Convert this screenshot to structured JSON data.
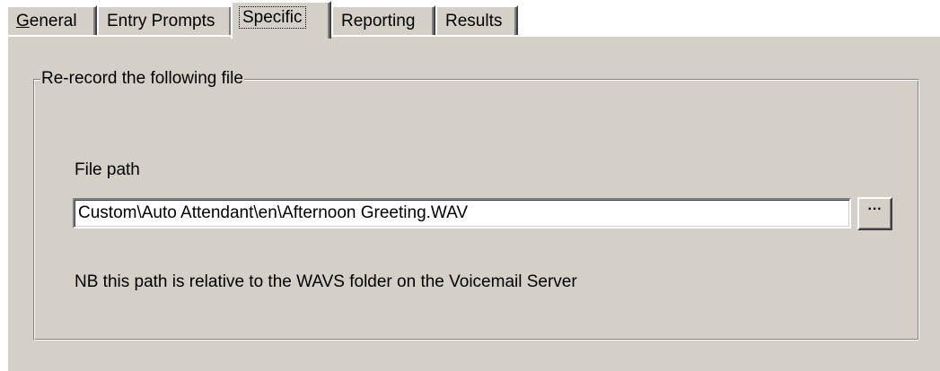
{
  "tabs": [
    {
      "mnemonic": "G",
      "rest": "eneral",
      "active": false
    },
    {
      "label": "Entry Prompts",
      "active": false
    },
    {
      "label": "Specific",
      "active": true
    },
    {
      "label": "Reporting",
      "active": false
    },
    {
      "label": "Results",
      "active": false
    }
  ],
  "group": {
    "title": "Re-record the following file"
  },
  "file_path": {
    "label": "File path",
    "value": "Custom\\Auto Attendant\\en\\Afternoon Greeting.WAV",
    "browse_label": "···"
  },
  "note": "NB this path is relative to the WAVS folder on the Voicemail Server",
  "colors": {
    "face": "#d4d0c8",
    "highlight": "#ffffff",
    "shadow": "#808080",
    "dark_shadow": "#404040",
    "input_bg": "#ffffff"
  }
}
